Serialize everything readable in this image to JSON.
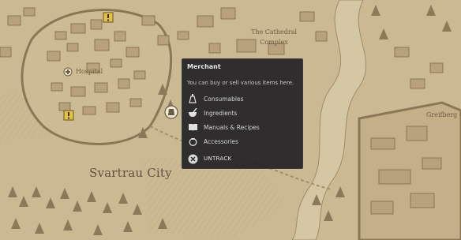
{
  "map": {
    "city_label": "Svartrau City",
    "cathedral_label": "The Cathedral\nComplex",
    "greifberg_label": "Greifberg C",
    "hospital_label": "Hospital",
    "colors": {
      "parchment": "#c9b792",
      "ink": "#6a5a42",
      "marker": "#e2c14a"
    }
  },
  "tooltip": {
    "title": "Merchant",
    "description": "You can buy or sell various items here.",
    "items": [
      {
        "icon": "potion-icon",
        "label": "Consumables"
      },
      {
        "icon": "mortar-icon",
        "label": "Ingredients"
      },
      {
        "icon": "book-icon",
        "label": "Manuals & Recipes"
      },
      {
        "icon": "pouch-icon",
        "label": "Accessories"
      }
    ],
    "untrack_label": "UNTRACK"
  }
}
